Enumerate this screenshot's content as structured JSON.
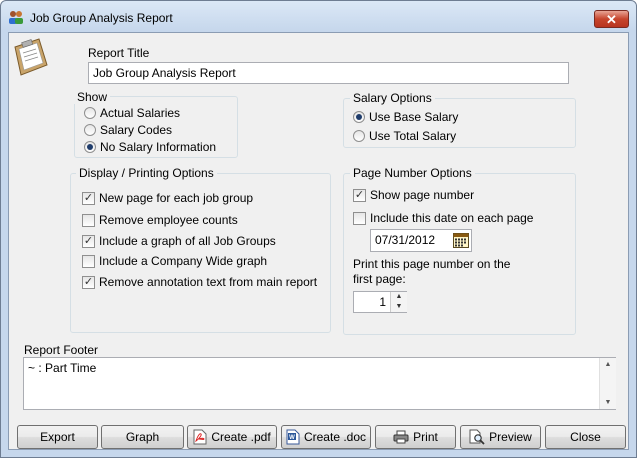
{
  "window": {
    "title": "Job Group Analysis Report"
  },
  "report_title": {
    "label": "Report Title",
    "value": "Job Group Analysis Report"
  },
  "show": {
    "label": "Show",
    "options": [
      "Actual Salaries",
      "Salary Codes",
      "No Salary Information"
    ],
    "selected": "No Salary Information"
  },
  "salary_options": {
    "label": "Salary Options",
    "options": [
      "Use Base Salary",
      "Use Total Salary"
    ],
    "selected": "Use Base Salary"
  },
  "display_printing": {
    "label": "Display / Printing Options",
    "items": [
      {
        "label": "New page for each job group",
        "checked": true
      },
      {
        "label": "Remove employee counts",
        "checked": false
      },
      {
        "label": "Include a graph of all Job Groups",
        "checked": true
      },
      {
        "label": "Include a Company Wide graph",
        "checked": false
      },
      {
        "label": "Remove annotation text from main report",
        "checked": true
      }
    ]
  },
  "page_number": {
    "label": "Page Number Options",
    "show_label": "Show page number",
    "show_checked": true,
    "include_date_label": "Include this date on each page",
    "include_date_checked": false,
    "date_value": "07/31/2012",
    "first_page_label_1": "Print this page number on the",
    "first_page_label_2": "first page:",
    "first_page_value": "1"
  },
  "footer": {
    "label": "Report Footer",
    "value": "~ : Part Time"
  },
  "buttons": {
    "export": "Export",
    "graph": "Graph",
    "create_pdf": "Create .pdf",
    "create_doc": "Create .doc",
    "print": "Print",
    "preview": "Preview",
    "close": "Close"
  },
  "icons": {
    "app": "app-people-icon",
    "clipboard": "clipboard-icon",
    "calendar": "calendar-icon",
    "pdf": "pdf-icon",
    "doc": "word-doc-icon",
    "print": "printer-icon",
    "preview": "preview-magnifier-icon"
  }
}
